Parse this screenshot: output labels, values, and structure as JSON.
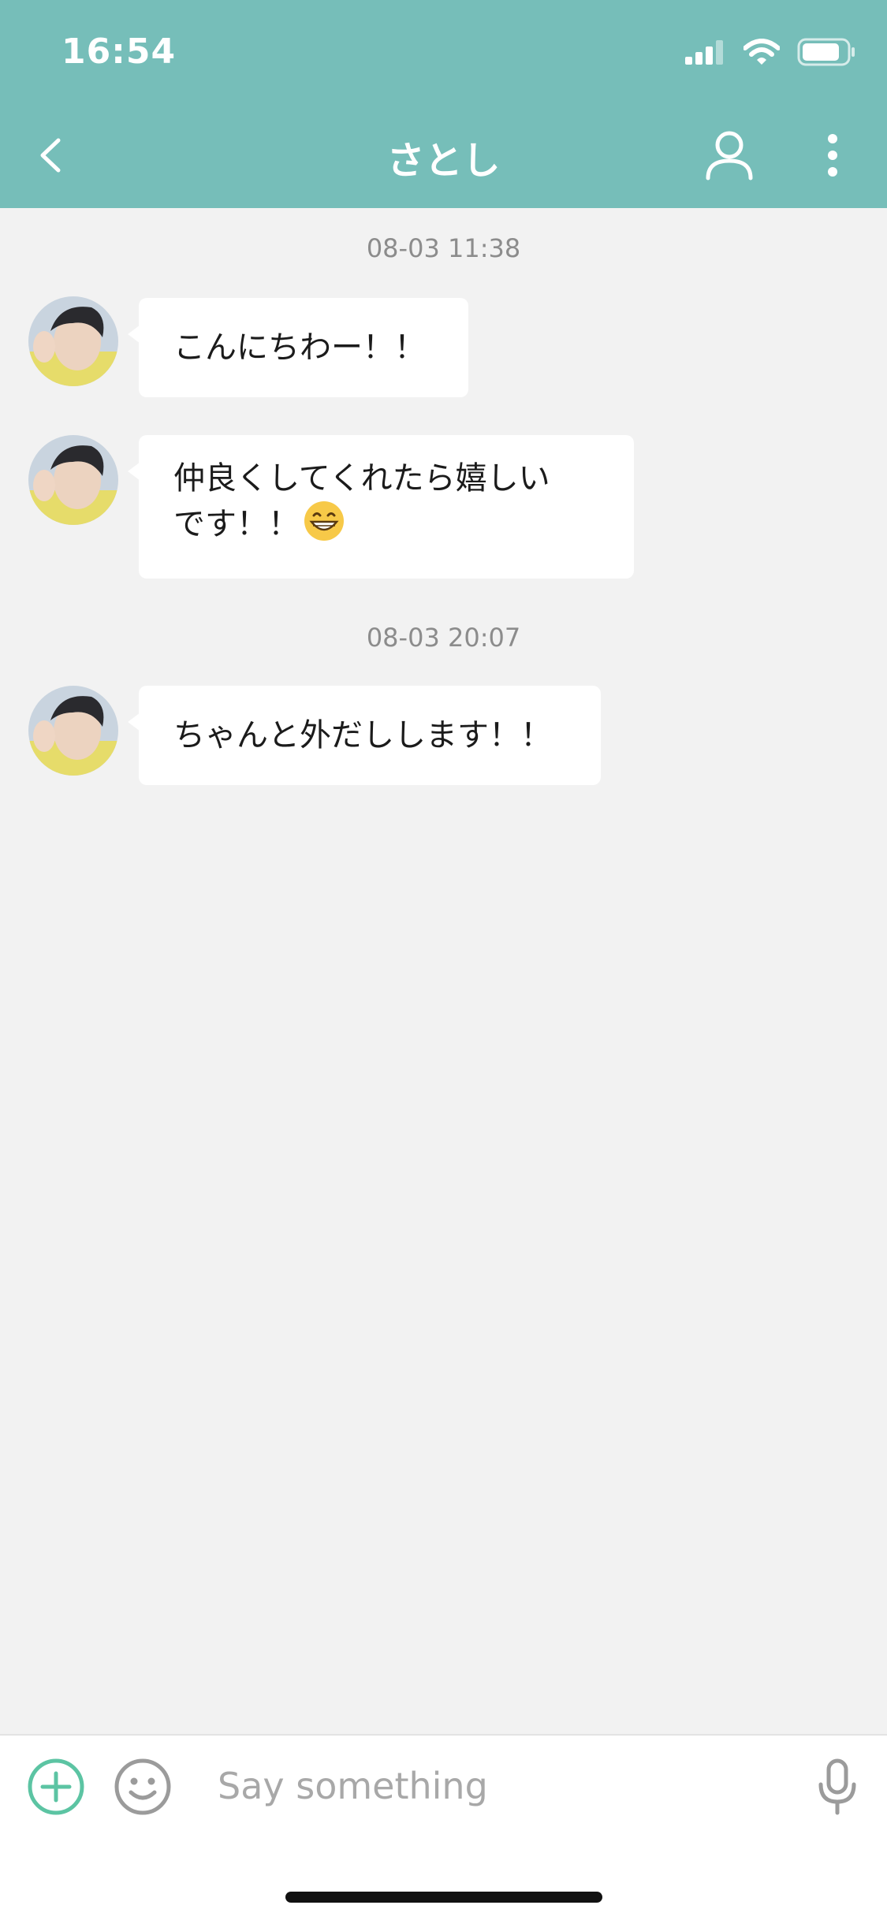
{
  "status_bar": {
    "time": "16:54"
  },
  "header": {
    "title": "さとし",
    "back_icon": "chevron-left-icon",
    "profile_icon": "person-icon",
    "more_icon": "vertical-dots-icon"
  },
  "messages": [
    {
      "timestamp": "08-03 11:38",
      "text": "こんにちわー！！"
    },
    {
      "text_line1": "仲良くしてくれたら嬉しい",
      "text_line2": "です！！",
      "emoji": "grinning-face-emoji"
    },
    {
      "timestamp": "08-03 20:07",
      "text": "ちゃんと外だしします！！"
    }
  ],
  "input_bar": {
    "placeholder": "Say something",
    "add_icon": "plus-circle-icon",
    "emoji_icon": "smiley-icon",
    "mic_icon": "microphone-icon"
  },
  "colors": {
    "header": "#76beb9",
    "background": "#f2f2f2",
    "accent_green": "#5cc4a3",
    "bubble": "#ffffff"
  }
}
